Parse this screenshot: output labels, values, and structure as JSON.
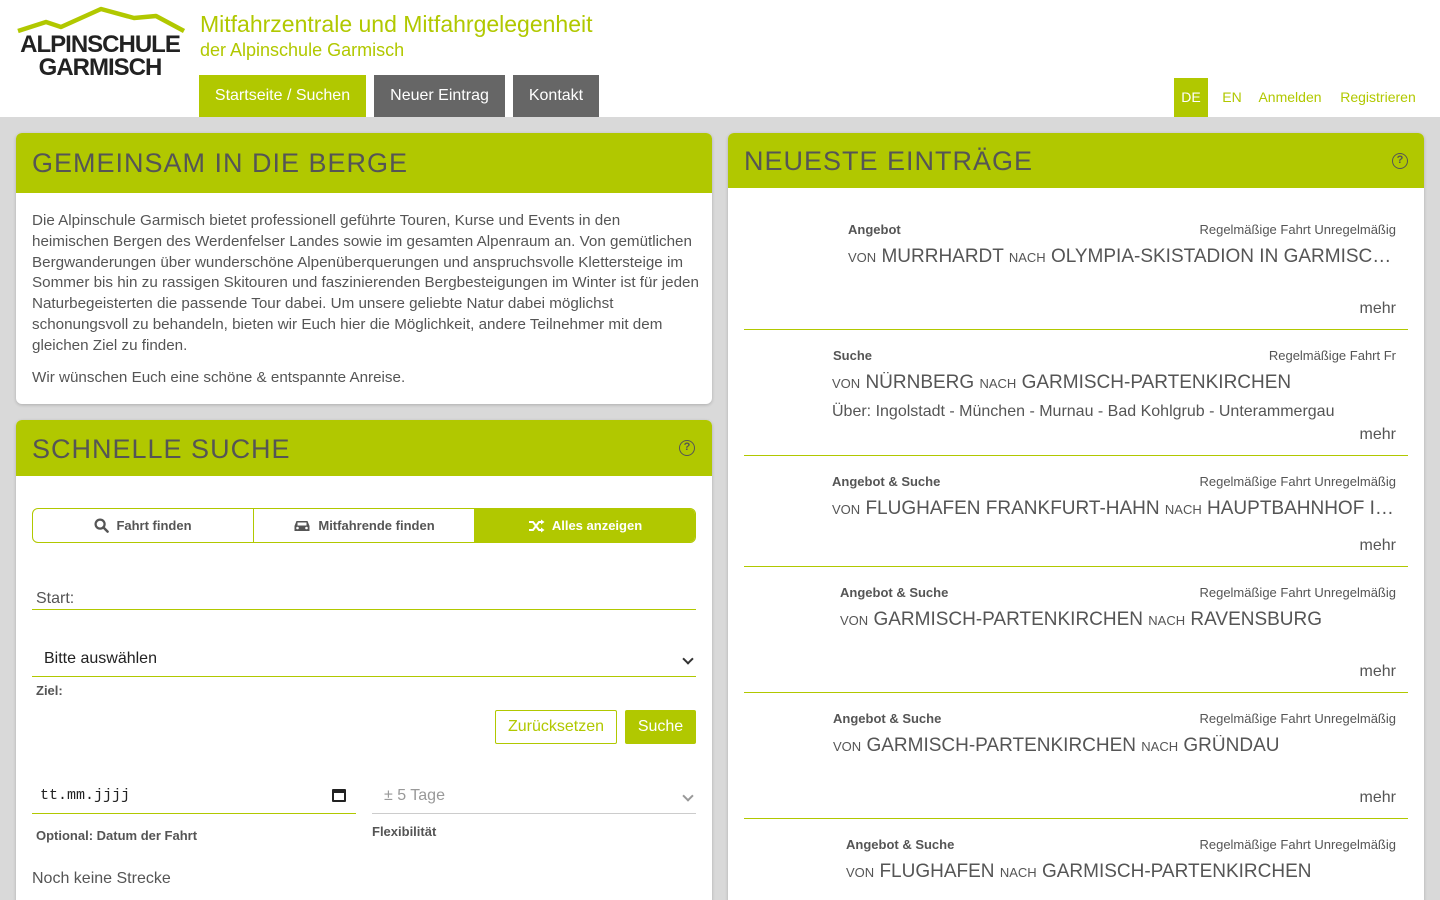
{
  "header": {
    "logo_line1": "ALPINSCHULE",
    "logo_line2": "GARMISCH",
    "title": "Mitfahrzentrale und Mitfahrgelegenheit",
    "subtitle": "der Alpinschule Garmisch",
    "nav": [
      "Startseite / Suchen",
      "Neuer Eintrag",
      "Kontakt"
    ],
    "lang": [
      "DE",
      "EN"
    ],
    "login": "Anmelden",
    "register": "Registrieren"
  },
  "intro": {
    "title": "GEMEINSAM IN DIE BERGE",
    "text": "Die Alpinschule Garmisch bietet professionell geführte Touren, Kurse und Events in den heimischen Bergen des Werdenfelser Landes sowie im gesamten Alpenraum an. Von gemütlichen Bergwanderungen über wunderschöne Alpenüberquerungen und anspruchsvolle Klettersteige im Sommer bis hin zu rassigen Skitouren und faszinierenden Bergbesteigungen im Winter ist für jeden Naturbegeisterten die passende Tour dabei. Um unsere geliebte Natur dabei möglichst schonungsvoll zu behandeln, bieten wir Euch hier die Möglichkeit, andere Teilnehmer mit dem gleichen Ziel zu finden.",
    "greeting": "Wir wünschen Euch eine schöne & entspannte Anreise."
  },
  "search": {
    "title": "SCHNELLE SUCHE",
    "help": "?",
    "tabs": [
      "Fahrt finden",
      "Mitfahrende finden",
      "Alles anzeigen"
    ],
    "start_placeholder": "Start:",
    "select_value": "Bitte auswählen",
    "ziel_label": "Ziel:",
    "reset": "Zurücksetzen",
    "submit": "Suche",
    "date_value": "tt.mm.jjjj",
    "date_label": "Optional: Datum der Fahrt",
    "flex_value": "± 5 Tage",
    "flex_label": "Flexibilität",
    "no_route": "Noch keine Strecke"
  },
  "entries": {
    "title": "NEUESTE EINTRÄGE",
    "help": "?",
    "von": "VON",
    "nach": "NACH",
    "more": "mehr",
    "items": [
      {
        "type": "Angebot",
        "regularity": "Regelmäßige Fahrt Unregelmäßig",
        "from": "MURRHARDT",
        "to": "OLYMPIA-SKISTADION IN GARMISCH-PARTENKIRCHEN",
        "via": ""
      },
      {
        "type": "Suche",
        "regularity": "Regelmäßige Fahrt Fr",
        "from": "NÜRNBERG",
        "to": "GARMISCH-PARTENKIRCHEN",
        "via": "Über: Ingolstadt - München - Murnau - Bad Kohlgrub - Unterammergau"
      },
      {
        "type": "Angebot & Suche",
        "regularity": "Regelmäßige Fahrt Unregelmäßig",
        "from": "FLUGHAFEN FRANKFURT-HAHN",
        "to": "HAUPTBAHNHOF IN GARMISCH-PARTENKIRCHEN",
        "via": ""
      },
      {
        "type": "Angebot & Suche",
        "regularity": "Regelmäßige Fahrt Unregelmäßig",
        "from": "GARMISCH-PARTENKIRCHEN",
        "to": "RAVENSBURG",
        "via": ""
      },
      {
        "type": "Angebot & Suche",
        "regularity": "Regelmäßige Fahrt Unregelmäßig",
        "from": "GARMISCH-PARTENKIRCHEN",
        "to": "GRÜNDAU",
        "via": ""
      },
      {
        "type": "Angebot & Suche",
        "regularity": "Regelmäßige Fahrt Unregelmäßig",
        "from": "FLUGHAFEN",
        "to": "GARMISCH-PARTENKIRCHEN",
        "via": ""
      }
    ]
  },
  "colors": {
    "accent": "#b1c800",
    "nav_dark": "#666666",
    "text": "#555555",
    "background": "#d9d9d9"
  }
}
